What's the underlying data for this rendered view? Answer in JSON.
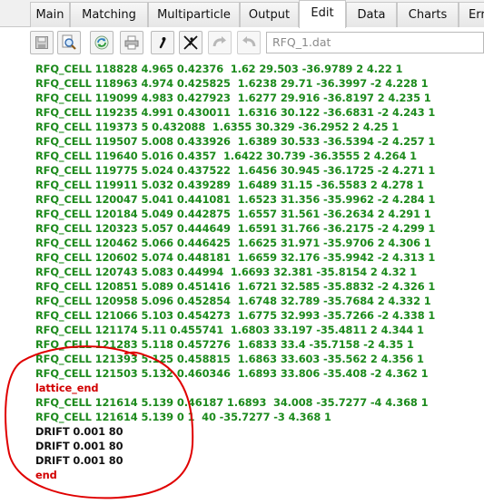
{
  "tabs": [
    {
      "label": "Main"
    },
    {
      "label": "Matching"
    },
    {
      "label": "Multiparticle"
    },
    {
      "label": "Output"
    },
    {
      "label": "Edit"
    },
    {
      "label": "Data"
    },
    {
      "label": "Charts"
    },
    {
      "label": "Err"
    }
  ],
  "active_tab": "Edit",
  "toolbar": {
    "icons": [
      "save-icon",
      "find-icon",
      "refresh-icon",
      "print-icon",
      "comment-icon",
      "uncomment-icon",
      "undo-icon",
      "redo-icon"
    ],
    "file_name": "RFQ_1.dat"
  },
  "colors": {
    "cell_text": "#1c8a1c",
    "keyword_text": "#d20000",
    "plain_text": "#111111",
    "annotation_circle": "#e00000"
  },
  "editor": {
    "lines": [
      {
        "text": "RFQ_CELL 118828 4.965 0.42376  1.62 29.503 -36.9789 2 4.22 1",
        "kind": "cell"
      },
      {
        "text": "RFQ_CELL 118963 4.974 0.425825  1.6238 29.71 -36.3997 -2 4.228 1",
        "kind": "cell"
      },
      {
        "text": "RFQ_CELL 119099 4.983 0.427923  1.6277 29.916 -36.8197 2 4.235 1",
        "kind": "cell"
      },
      {
        "text": "RFQ_CELL 119235 4.991 0.430011  1.6316 30.122 -36.6831 -2 4.243 1",
        "kind": "cell"
      },
      {
        "text": "RFQ_CELL 119373 5 0.432088  1.6355 30.329 -36.2952 2 4.25 1",
        "kind": "cell"
      },
      {
        "text": "RFQ_CELL 119507 5.008 0.433926  1.6389 30.533 -36.5394 -2 4.257 1",
        "kind": "cell"
      },
      {
        "text": "RFQ_CELL 119640 5.016 0.4357  1.6422 30.739 -36.3555 2 4.264 1",
        "kind": "cell"
      },
      {
        "text": "RFQ_CELL 119775 5.024 0.437522  1.6456 30.945 -36.1725 -2 4.271 1",
        "kind": "cell"
      },
      {
        "text": "RFQ_CELL 119911 5.032 0.439289  1.6489 31.15 -36.5583 2 4.278 1",
        "kind": "cell"
      },
      {
        "text": "RFQ_CELL 120047 5.041 0.441081  1.6523 31.356 -35.9962 -2 4.284 1",
        "kind": "cell"
      },
      {
        "text": "RFQ_CELL 120184 5.049 0.442875  1.6557 31.561 -36.2634 2 4.291 1",
        "kind": "cell"
      },
      {
        "text": "RFQ_CELL 120323 5.057 0.444649  1.6591 31.766 -36.2175 -2 4.299 1",
        "kind": "cell"
      },
      {
        "text": "RFQ_CELL 120462 5.066 0.446425  1.6625 31.971 -35.9706 2 4.306 1",
        "kind": "cell"
      },
      {
        "text": "RFQ_CELL 120602 5.074 0.448181  1.6659 32.176 -35.9942 -2 4.313 1",
        "kind": "cell"
      },
      {
        "text": "RFQ_CELL 120743 5.083 0.44994  1.6693 32.381 -35.8154 2 4.32 1",
        "kind": "cell"
      },
      {
        "text": "RFQ_CELL 120851 5.089 0.451416  1.6721 32.585 -35.8832 -2 4.326 1",
        "kind": "cell"
      },
      {
        "text": "RFQ_CELL 120958 5.096 0.452854  1.6748 32.789 -35.7684 2 4.332 1",
        "kind": "cell"
      },
      {
        "text": "RFQ_CELL 121066 5.103 0.454273  1.6775 32.993 -35.7266 -2 4.338 1",
        "kind": "cell"
      },
      {
        "text": "RFQ_CELL 121174 5.11 0.455741  1.6803 33.197 -35.4811 2 4.344 1",
        "kind": "cell"
      },
      {
        "text": "RFQ_CELL 121283 5.118 0.457276  1.6833 33.4 -35.7158 -2 4.35 1",
        "kind": "cell"
      },
      {
        "text": "RFQ_CELL 121393 5.125 0.458815  1.6863 33.603 -35.562 2 4.356 1",
        "kind": "cell"
      },
      {
        "text": "RFQ_CELL 121503 5.132 0.460346  1.6893 33.806 -35.408 -2 4.362 1",
        "kind": "cell"
      },
      {
        "text": "lattice_end",
        "kind": "keyword"
      },
      {
        "text": "RFQ_CELL 121614 5.139 0.46187 1.6893  34.008 -35.7277 -4 4.368 1",
        "kind": "cell"
      },
      {
        "text": "RFQ_CELL 121614 5.139 0 1  40 -35.7277 -3 4.368 1",
        "kind": "cell"
      },
      {
        "text": "DRIFT 0.001 80",
        "kind": "plain"
      },
      {
        "text": "DRIFT 0.001 80",
        "kind": "plain"
      },
      {
        "text": "DRIFT 0.001 80",
        "kind": "plain"
      },
      {
        "text": "end",
        "kind": "keyword"
      }
    ]
  }
}
